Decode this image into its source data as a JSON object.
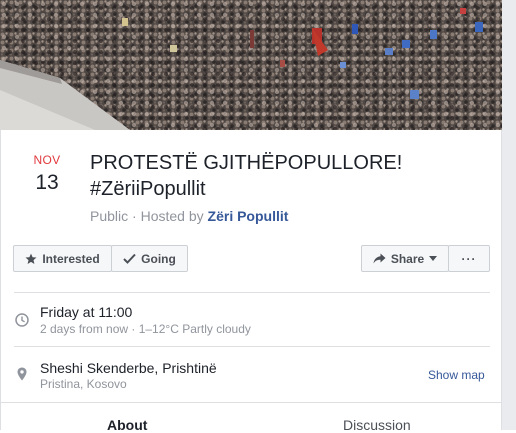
{
  "event": {
    "month": "NOV",
    "day": "13",
    "title": "PROTESTË GJITHËPOPULLORE! #ZëriiPopullit",
    "privacy": "Public",
    "hosted_by": "Hosted by",
    "host": "Zëri Popullit"
  },
  "actions": {
    "interested": "Interested",
    "going": "Going",
    "share": "Share",
    "more": "···"
  },
  "details": {
    "time_primary": "Friday at 11:00",
    "time_secondary": "2 days from now · 1–12°C Partly cloudy",
    "location_primary": "Sheshi Skenderbe, Prishtinë",
    "location_secondary": "Pristina, Kosovo",
    "show_map": "Show map"
  },
  "tabs": [
    "About",
    "Discussion"
  ],
  "colors": {
    "month": "#e0393e",
    "link": "#365899",
    "muted": "#90949c"
  }
}
